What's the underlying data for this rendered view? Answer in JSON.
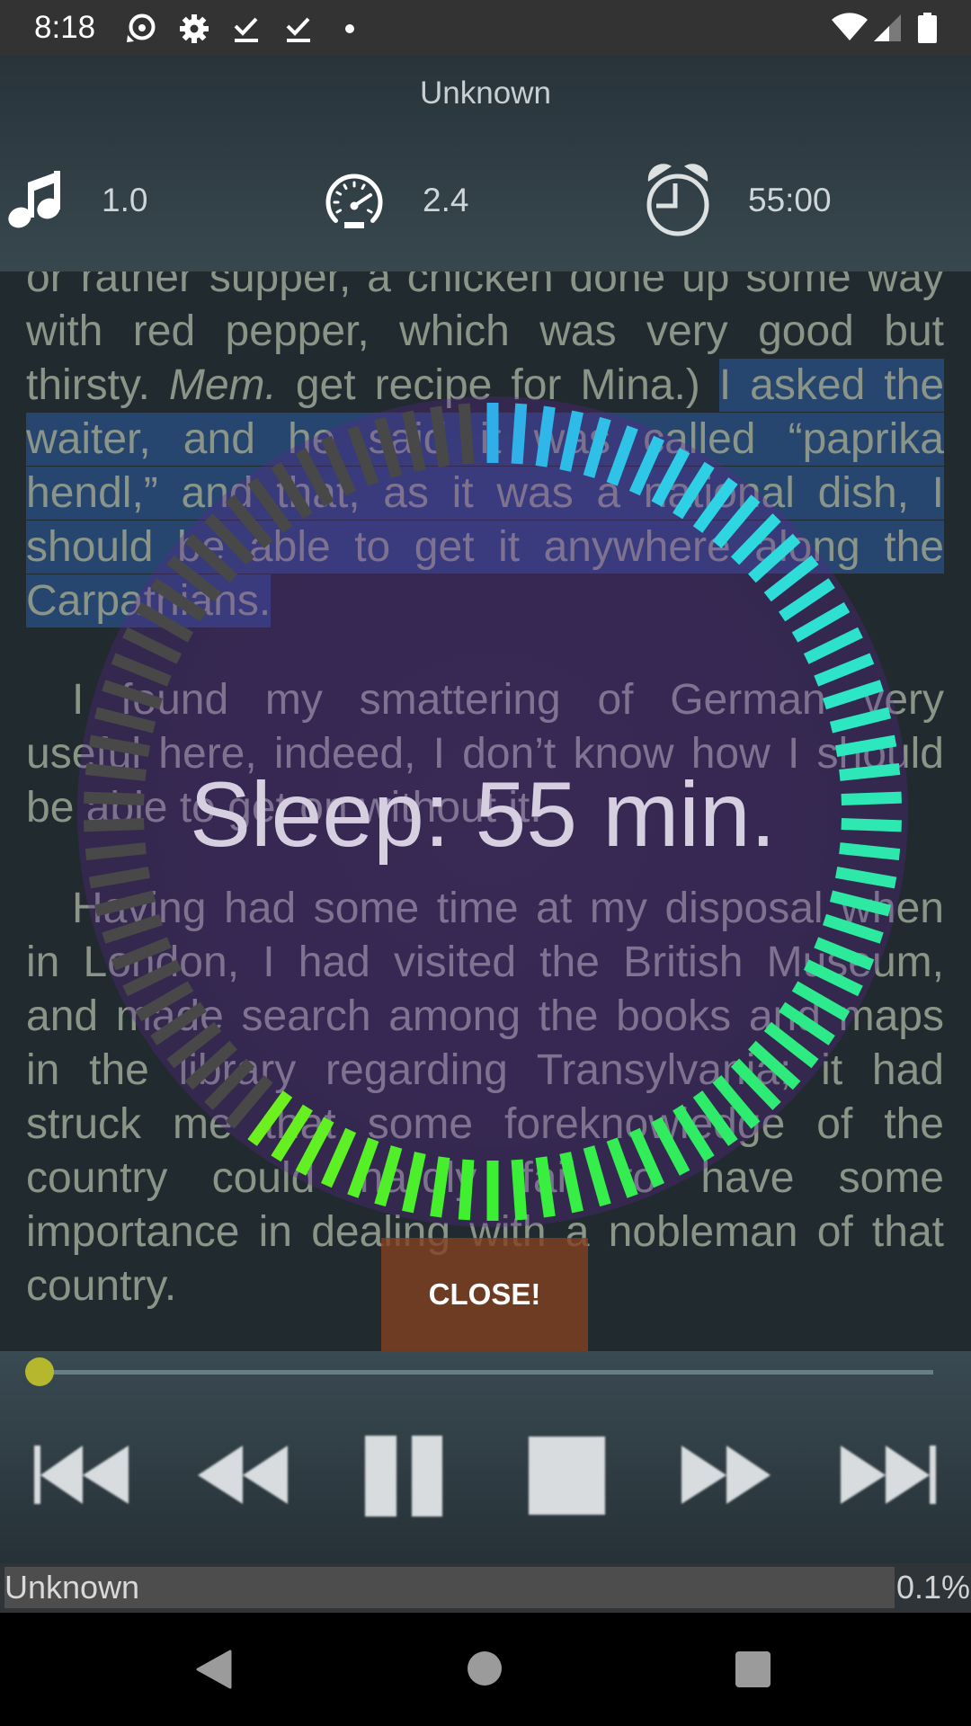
{
  "status_bar": {
    "time": "8:18",
    "notification_icons": [
      "audio-player-icon",
      "settings-gear-icon",
      "download-done-icon",
      "download-done-icon",
      "more-notifications-dot-icon"
    ],
    "system_icons": [
      "wifi-icon",
      "cellular-signal-icon",
      "battery-icon"
    ]
  },
  "header": {
    "title": "Unknown",
    "pitch": {
      "icon": "music-note-icon",
      "value": "1.0"
    },
    "speed": {
      "icon": "speedometer-icon",
      "value": "2.4"
    },
    "sleep_timer": {
      "icon": "alarm-clock-icon",
      "value": "55:00"
    }
  },
  "reader": {
    "text_color": "#8a9588",
    "selection_color": "#27466f",
    "paragraphs": [
      {
        "lines": [
          {
            "text": "or rather supper, a chicken done up some way"
          },
          {
            "text": "with red pepper, which was very good but"
          },
          {
            "segments": [
              {
                "text": "thirsty. "
              },
              {
                "text": "Mem.",
                "italic": true
              },
              {
                "text": " get recipe for Mina.) "
              },
              {
                "text": "I asked the",
                "selected": true
              }
            ]
          },
          {
            "text": "waiter, and he said it was called “paprika",
            "selected": true
          },
          {
            "text": "hendl,” and that, as it was a national dish, I",
            "selected": true
          },
          {
            "text": "should be able to get it anywhere along the",
            "selected": true
          },
          {
            "text": "Carpathians.",
            "selected": true
          }
        ]
      },
      {
        "lines": [
          {
            "text": "I found my smattering of German very"
          },
          {
            "text": "useful here, indeed, I don’t know how I should"
          },
          {
            "text": "be able to get on without it."
          }
        ]
      },
      {
        "lines": [
          {
            "text": "Having had some time at my disposal when"
          },
          {
            "text": "in London, I had visited the British Museum,"
          },
          {
            "text": "and made search among the books and maps"
          },
          {
            "text": "in the library regarding Transylvania; it had"
          },
          {
            "text": "struck me that some foreknowledge of the"
          },
          {
            "text": "country could hardly fail to have some"
          },
          {
            "text": "importance in dealing with a nobleman of that"
          },
          {
            "text": "country."
          }
        ]
      }
    ]
  },
  "sleep_overlay": {
    "label": "Sleep: 55 min.",
    "minutes": 55,
    "max_minutes": 90,
    "active_tick_colors": [
      "#30aee8",
      "#2ed4e6",
      "#2de6c6",
      "#2de9a0",
      "#2eec6a",
      "#3bef32",
      "#6cf01e"
    ],
    "inactive_tick_color": "#484848",
    "close_button_label": "CLOSE!",
    "close_button_color": "#6e3a24"
  },
  "player": {
    "seek_position_fraction": 0.0,
    "thumb_color": "#b5b82c",
    "controls": [
      {
        "icon": "skip-previous-icon"
      },
      {
        "icon": "rewind-icon"
      },
      {
        "icon": "pause-icon"
      },
      {
        "icon": "stop-icon"
      },
      {
        "icon": "fast-forward-icon"
      },
      {
        "icon": "skip-next-icon"
      }
    ]
  },
  "footer": {
    "title": "Unknown",
    "progress": "0.1%"
  },
  "nav_bar": {
    "buttons": [
      "back-icon",
      "home-icon",
      "recents-icon"
    ]
  }
}
